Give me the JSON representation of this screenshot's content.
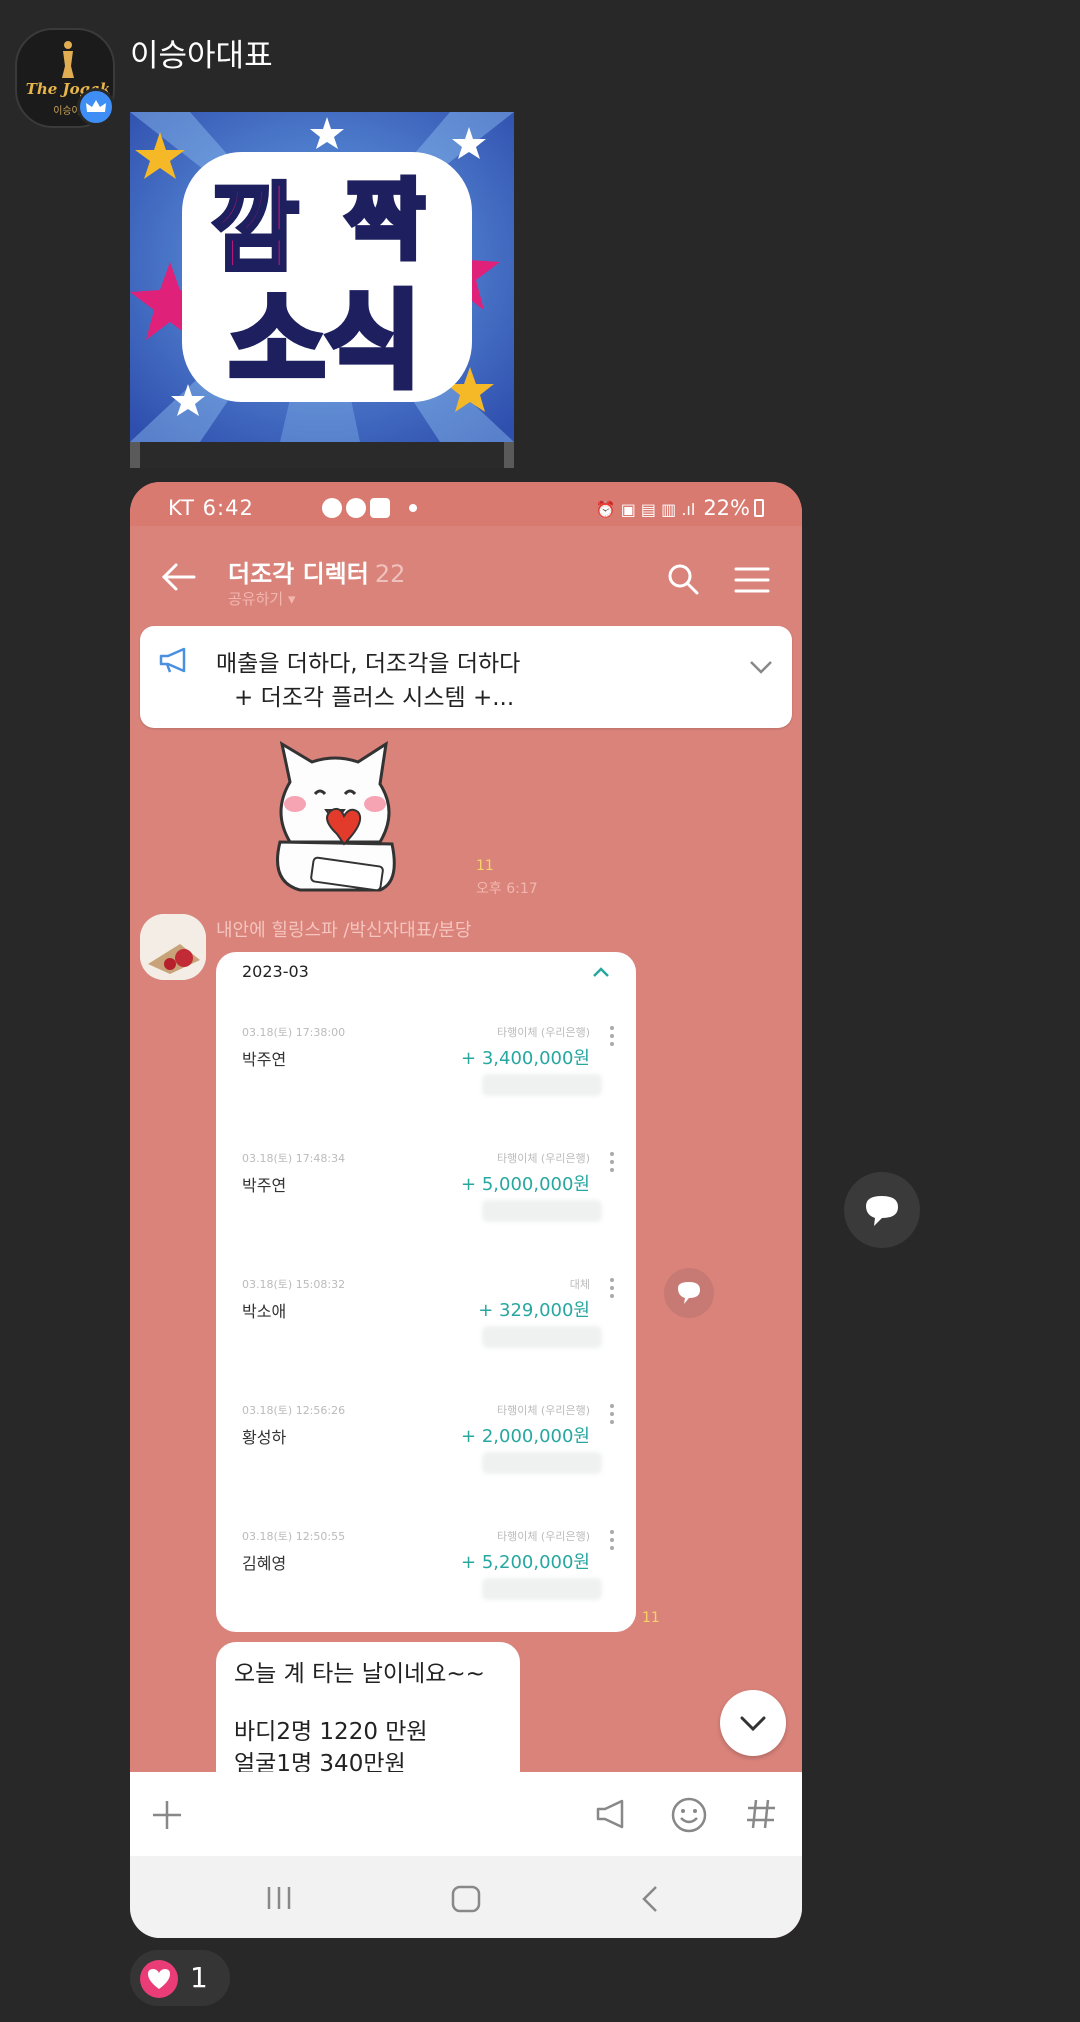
{
  "sender": {
    "name": "이승아대표",
    "avatar_text": "The Jogak",
    "avatar_sub": "이승아"
  },
  "sticker": {
    "line1_left": "깜",
    "line1_right": "짝",
    "line2": "소식"
  },
  "screenshot": {
    "status_left": "KT 6:42",
    "status_right": "22%",
    "room_title": "더조각 디렉터",
    "room_count": "22",
    "room_sub": "공유하기 ▾",
    "notice_line1": "매출을 더하다, 더조각을 더하다",
    "notice_line2": "+ 더조각 플러스 시스템 +...",
    "sticker_unread": "11",
    "sticker_time": "오후 6:17",
    "member_name": "내안에 힐링스파 /박신자대표/분당",
    "bank_month": "2023-03",
    "transactions": [
      {
        "date": "03.18(토) 17:38:00",
        "name": "박주연",
        "type": "타행이체 (우리은행)",
        "amount": "+ 3,400,000원"
      },
      {
        "date": "03.18(토) 17:48:34",
        "name": "박주연",
        "type": "타행이체 (우리은행)",
        "amount": "+ 5,000,000원"
      },
      {
        "date": "03.18(토) 15:08:32",
        "name": "박소애",
        "type": "대체",
        "amount": "+ 329,000원"
      },
      {
        "date": "03.18(토) 12:56:26",
        "name": "황성하",
        "type": "타행이체 (우리은행)",
        "amount": "+ 2,000,000원"
      },
      {
        "date": "03.18(토) 12:50:55",
        "name": "김혜영",
        "type": "타행이체 (우리은행)",
        "amount": "+ 5,200,000원"
      }
    ],
    "bank_unread": "11",
    "message_line1": "오늘 계 타는 날이네요~~",
    "message_line2": "바디2명 1220 만원",
    "message_line3": "얼굴1명 340만원"
  },
  "reaction": {
    "count": "1"
  },
  "colors": {
    "background": "#282828",
    "chat_bg": "#d9837a",
    "accent_green": "#28a7a0",
    "heart": "#ea3d78",
    "badge_blue": "#3f8ef5"
  }
}
